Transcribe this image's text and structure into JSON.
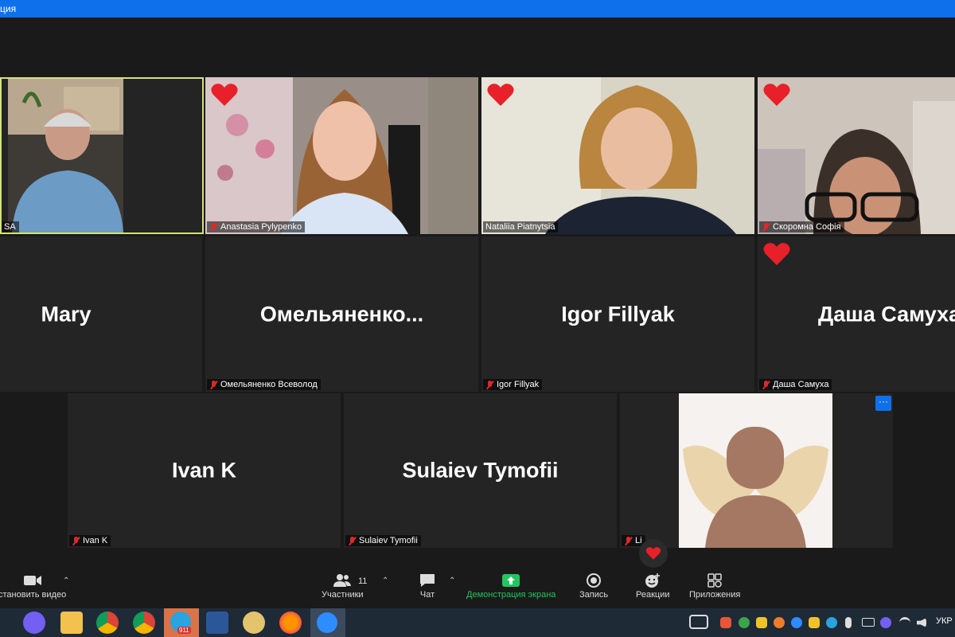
{
  "window": {
    "title": "ция"
  },
  "tiles": {
    "t1": {
      "label": "SA"
    },
    "t2": {
      "label": "Anastasia Pylypenko"
    },
    "t3": {
      "label": "Nataliia Piatnytsia"
    },
    "t4": {
      "label": "Скоромна Софія"
    },
    "t5": {
      "big": "Mary"
    },
    "t6": {
      "big": "Омельяненко...",
      "label": "Омельяненко Всеволод"
    },
    "t7": {
      "big": "Igor Fillyak",
      "label": "Igor Fillyak"
    },
    "t8": {
      "big": "Даша Самуха",
      "label": "Даша Самуха"
    },
    "t9": {
      "big": "Ivan K",
      "label": "Ivan K"
    },
    "t10": {
      "big": "Sulaiev Tymofii",
      "label": "Sulaiev Tymofii"
    },
    "t11": {
      "label": "Li",
      "more": "···"
    }
  },
  "toolbar": {
    "video": "становить видео",
    "participants": "Участники",
    "participants_count": "11",
    "chat": "Чат",
    "share": "Демонстрация экрана",
    "record": "Запись",
    "reactions": "Реакции",
    "apps": "Приложения"
  },
  "taskbar": {
    "telegram_badge": "911",
    "lang": "УКР"
  },
  "colors": {
    "heart": "#e8202a",
    "share_green": "#22c55e",
    "zoom_blue": "#0e71eb",
    "active_border": "#d6e37a"
  }
}
